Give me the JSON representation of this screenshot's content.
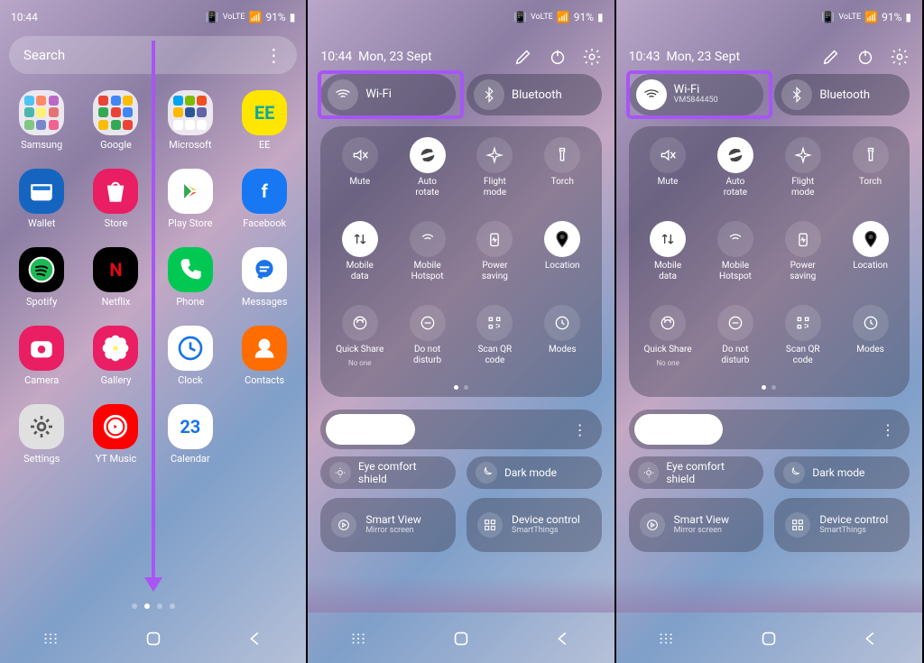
{
  "panel1": {
    "status_time": "10:44",
    "status_battery": "91%",
    "search_placeholder": "Search",
    "apps": [
      {
        "label": "Samsung",
        "type": "folder",
        "colors": [
          "#4fc3f7",
          "#ff8a65",
          "#ba68c8",
          "#4db6ac",
          "#fff176",
          "#e57373",
          "#81c784",
          "#7986cb",
          "#f06292"
        ]
      },
      {
        "label": "Google",
        "type": "folder",
        "colors": [
          "#ea4335",
          "#4285f4",
          "#fbbc05",
          "#34a853",
          "#ea4335",
          "#4285f4",
          "#fbbc05",
          "#34a853",
          "#ea4335"
        ]
      },
      {
        "label": "Microsoft",
        "type": "folder",
        "colors": [
          "#00a4ef",
          "#7fba00",
          "#f25022",
          "#ffb900",
          "#2b579a",
          "#6264a7",
          "#ffffff",
          "#ffffff",
          "#ffffff"
        ]
      },
      {
        "label": "EE",
        "bg": "#ffe600",
        "fg": "#0aa89e",
        "text": "EE"
      },
      {
        "label": "Wallet",
        "bg": "#1565c0",
        "svg": "wallet"
      },
      {
        "label": "Store",
        "bg": "#e91e63",
        "svg": "store"
      },
      {
        "label": "Play Store",
        "bg": "#ffffff",
        "svg": "play"
      },
      {
        "label": "Facebook",
        "bg": "#1877f2",
        "text": "f"
      },
      {
        "label": "Spotify",
        "bg": "#000000",
        "fg": "#1db954",
        "svg": "spotify"
      },
      {
        "label": "Netflix",
        "bg": "#000000",
        "fg": "#e50914",
        "text": "N"
      },
      {
        "label": "Phone",
        "bg": "#00c853",
        "svg": "phone"
      },
      {
        "label": "Messages",
        "bg": "#ffffff",
        "fg": "#1a73e8",
        "svg": "message"
      },
      {
        "label": "Camera",
        "bg": "#e91e63",
        "svg": "camera"
      },
      {
        "label": "Gallery",
        "bg": "#e91e63",
        "svg": "flower"
      },
      {
        "label": "Clock",
        "bg": "#ffffff",
        "fg": "#1a73e8",
        "svg": "clock"
      },
      {
        "label": "Contacts",
        "bg": "#ff6d00",
        "svg": "person"
      },
      {
        "label": "Settings",
        "bg": "#e0e0e0",
        "fg": "#555",
        "svg": "gear"
      },
      {
        "label": "YT Music",
        "bg": "#ff0000",
        "svg": "ytm"
      },
      {
        "label": "Calendar",
        "bg": "#ffffff",
        "fg": "#1a73e8",
        "text": "23"
      }
    ]
  },
  "panel2": {
    "status_battery": "91%",
    "qp_time": "10:44",
    "qp_date": "Mon, 23 Sept",
    "wifi": {
      "title": "Wi-Fi",
      "sub": "",
      "on": false
    },
    "bt": {
      "title": "Bluetooth",
      "on": false
    },
    "qs": [
      {
        "label": "Mute",
        "on": false,
        "i": "mute"
      },
      {
        "label": "Auto\nrotate",
        "on": true,
        "i": "rotate"
      },
      {
        "label": "Flight\nmode",
        "on": false,
        "i": "plane"
      },
      {
        "label": "Torch",
        "on": false,
        "i": "torch"
      },
      {
        "label": "Mobile\ndata",
        "on": true,
        "i": "data"
      },
      {
        "label": "Mobile\nHotspot",
        "on": false,
        "i": "hotspot"
      },
      {
        "label": "Power\nsaving",
        "on": false,
        "i": "power"
      },
      {
        "label": "Location",
        "on": true,
        "i": "location"
      },
      {
        "label": "Quick Share",
        "sub": "No one",
        "on": false,
        "i": "qshare"
      },
      {
        "label": "Do not\ndisturb",
        "on": false,
        "i": "dnd"
      },
      {
        "label": "Scan QR\ncode",
        "on": false,
        "i": "qr"
      },
      {
        "label": "Modes",
        "on": false,
        "i": "modes"
      }
    ],
    "eye": "Eye comfort shield",
    "dark": "Dark mode",
    "sv_title": "Smart View",
    "sv_sub": "Mirror screen",
    "dc_title": "Device control",
    "dc_sub": "SmartThings"
  },
  "panel3": {
    "status_battery": "91%",
    "qp_time": "10:43",
    "qp_date": "Mon, 23 Sept",
    "wifi": {
      "title": "Wi-Fi",
      "sub": "VM5844450",
      "on": true
    },
    "bt": {
      "title": "Bluetooth",
      "on": false
    },
    "qs": [
      {
        "label": "Mute",
        "on": false,
        "i": "mute"
      },
      {
        "label": "Auto\nrotate",
        "on": true,
        "i": "rotate"
      },
      {
        "label": "Flight\nmode",
        "on": false,
        "i": "plane"
      },
      {
        "label": "Torch",
        "on": false,
        "i": "torch"
      },
      {
        "label": "Mobile\ndata",
        "on": true,
        "i": "data"
      },
      {
        "label": "Mobile\nHotspot",
        "on": false,
        "i": "hotspot"
      },
      {
        "label": "Power\nsaving",
        "on": false,
        "i": "power"
      },
      {
        "label": "Location",
        "on": true,
        "i": "location"
      },
      {
        "label": "Quick Share",
        "sub": "No one",
        "on": false,
        "i": "qshare"
      },
      {
        "label": "Do not\ndisturb",
        "on": false,
        "i": "dnd"
      },
      {
        "label": "Scan QR\ncode",
        "on": false,
        "i": "qr"
      },
      {
        "label": "Modes",
        "on": false,
        "i": "modes"
      }
    ],
    "eye": "Eye comfort shield",
    "dark": "Dark mode",
    "sv_title": "Smart View",
    "sv_sub": "Mirror screen",
    "dc_title": "Device control",
    "dc_sub": "SmartThings"
  }
}
